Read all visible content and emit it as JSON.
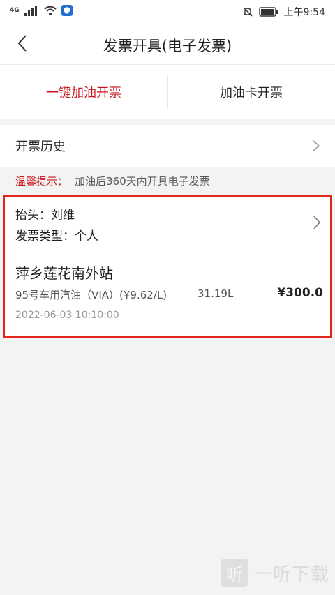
{
  "status_bar": {
    "network": "4G",
    "time": "上午9:54"
  },
  "header": {
    "title": "发票开具(电子发票)"
  },
  "tabs": [
    {
      "label": "一键加油开票",
      "active": true
    },
    {
      "label": "加油卡开票",
      "active": false
    }
  ],
  "history": {
    "label": "开票历史"
  },
  "tip": {
    "label": "温馨提示：",
    "text": "加油后360天内开具电子发票"
  },
  "invoice": {
    "title_line": "抬头：刘维",
    "type_line": "发票类型：个人",
    "station": "萍乡莲花南外站",
    "fuel_detail": "95号车用汽油（VIA）(¥9.62/L)",
    "volume": "31.19L",
    "amount": "¥300.0",
    "datetime": "2022-06-03 10:10:00"
  },
  "watermark": {
    "logo_char": "听",
    "text": "一听下载"
  },
  "colors": {
    "accent": "#c8161d",
    "highlight_border": "#e1251b",
    "background": "#f3f3f3"
  }
}
